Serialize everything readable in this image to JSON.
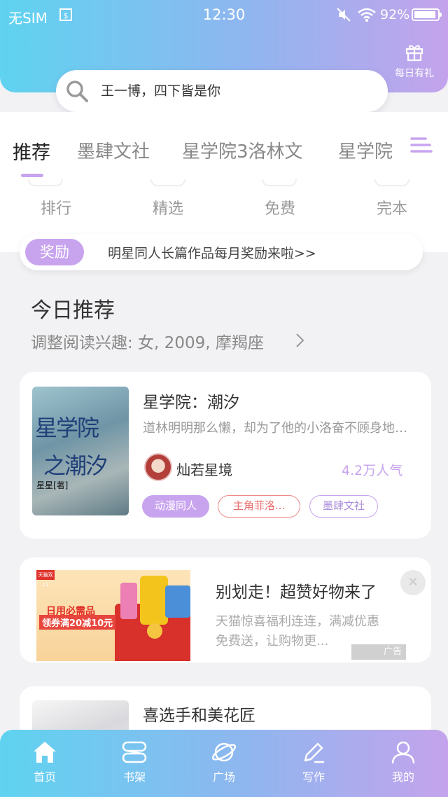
{
  "status_bar": {
    "carrier": "无SIM",
    "time": "12:30",
    "battery": "92%"
  },
  "header": {
    "gift_label": "每日有礼",
    "search_placeholder": "王一博，四下皆是你"
  },
  "tabs": [
    "推荐",
    "墨肆文社",
    "星学院3洛林文",
    "星学院"
  ],
  "quick_links": [
    "排行",
    "精选",
    "免费",
    "完本"
  ],
  "reward": {
    "badge": "奖励",
    "text": "明星同人长篇作品每月奖励来啦>>"
  },
  "section": {
    "title": "今日推荐",
    "subtitle": "调整阅读兴趣: 女, 2009, 摩羯座"
  },
  "book1": {
    "cover_title": "星学院",
    "cover_subtitle": "之潮汐",
    "cover_author": "星星[著]",
    "title": "星学院：潮汐",
    "description": "道林明明那么懒，却为了他的小洛奋不顾身地去努力",
    "author": "灿若星境",
    "popularity": "4.2万人气",
    "tags": [
      "动漫同人",
      "主角菲洛...",
      "墨肆文社"
    ]
  },
  "ad": {
    "title": "别划走！超赞好物来了",
    "description": "天猫惊喜福利连连，满减优惠免费送，让购物更...",
    "label": "广告",
    "close_glyph": "✕",
    "image_logo_text": "天猫双11",
    "image_line1": "日用必需品",
    "image_line2": "领券满20减10元"
  },
  "book2": {
    "title": "喜选手和美花匠"
  },
  "bottom_nav": [
    {
      "label": "首页",
      "icon": "home-icon"
    },
    {
      "label": "书架",
      "icon": "bookshelf-icon"
    },
    {
      "label": "广场",
      "icon": "planet-icon"
    },
    {
      "label": "写作",
      "icon": "pen-icon"
    },
    {
      "label": "我的",
      "icon": "user-icon"
    }
  ],
  "colors": {
    "gradient_start": "#5fd3f0",
    "gradient_end": "#c4a3ec",
    "accent_purple": "#c8a4ef",
    "tag_red": "#ef8a8a"
  }
}
